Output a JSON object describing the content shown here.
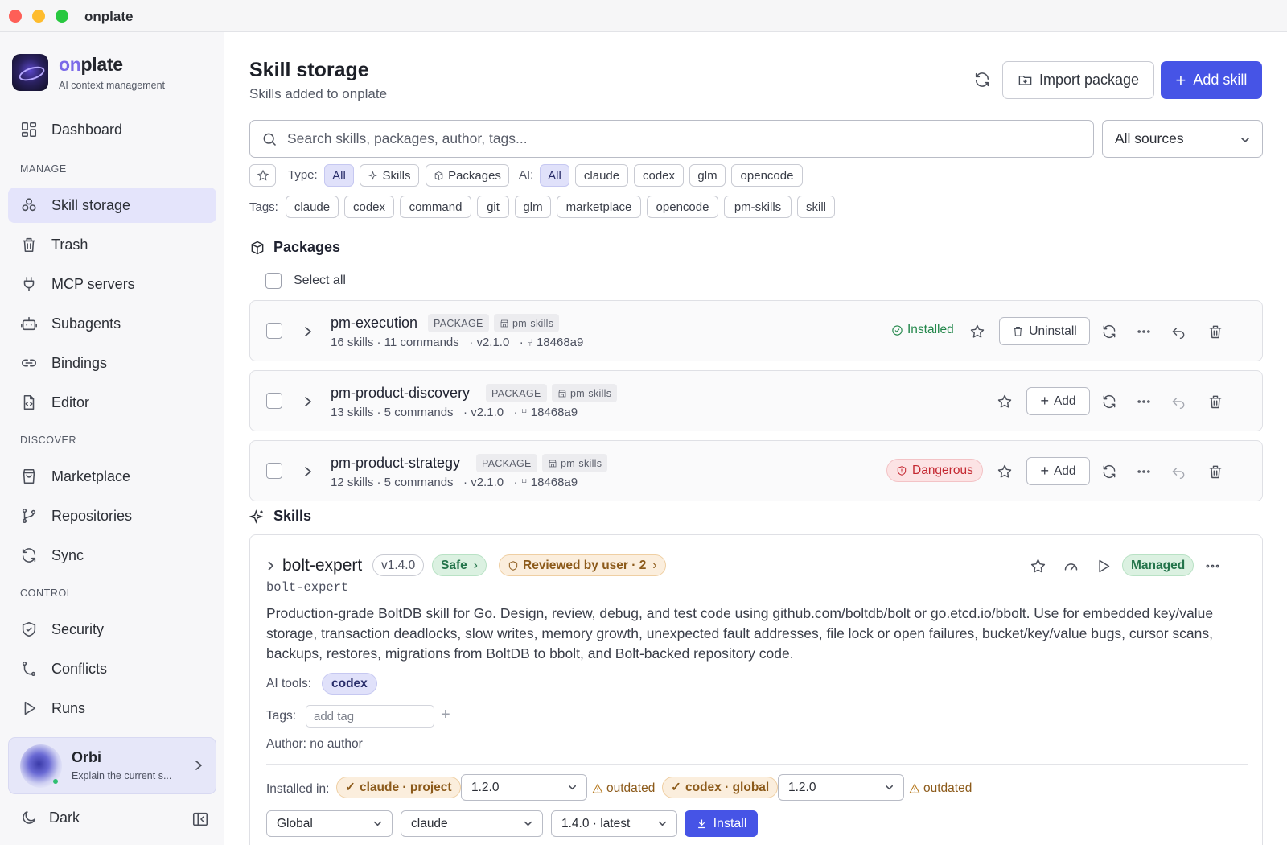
{
  "window": {
    "title": "onplate"
  },
  "brand": {
    "name_prefix": "on",
    "name_suffix": "plate",
    "subtitle": "AI context management"
  },
  "sidebar": {
    "dashboard": "Dashboard",
    "sections": {
      "manage": "MANAGE",
      "discover": "DISCOVER",
      "control": "CONTROL"
    },
    "manage_items": [
      "Skill storage",
      "Trash",
      "MCP servers",
      "Subagents",
      "Bindings",
      "Editor"
    ],
    "discover_items": [
      "Marketplace",
      "Repositories",
      "Sync"
    ],
    "control_items": [
      "Security",
      "Conflicts",
      "Runs"
    ],
    "active_item": "Skill storage",
    "assistant": {
      "name": "Orbi",
      "subtitle": "Explain the current s..."
    },
    "theme_label": "Dark"
  },
  "header": {
    "title": "Skill storage",
    "subtitle": "Skills added to onplate",
    "import_label": "Import package",
    "add_label": "Add skill"
  },
  "search": {
    "placeholder": "Search skills, packages, author, tags...",
    "sources_value": "All sources"
  },
  "filters": {
    "type_label": "Type:",
    "type_options": [
      "All",
      "Skills",
      "Packages"
    ],
    "type_selected": "All",
    "ai_label": "AI:",
    "ai_options": [
      "All",
      "claude",
      "codex",
      "glm",
      "opencode"
    ],
    "ai_selected": "All",
    "tags_label": "Tags:",
    "tags": [
      "claude",
      "codex",
      "command",
      "git",
      "glm",
      "marketplace",
      "opencode",
      "pm-skills",
      "skill"
    ]
  },
  "packages": {
    "heading": "Packages",
    "select_all": "Select all",
    "items": [
      {
        "name": "pm-execution",
        "kind": "PACKAGE",
        "source": "pm-skills",
        "meta": "16 skills · 11 commands   · v2.1.0   ·",
        "commit": "18468a9",
        "status": "Installed",
        "action": "Uninstall"
      },
      {
        "name": "pm-product-discovery",
        "kind": "PACKAGE",
        "source": "pm-skills",
        "meta": "13 skills · 5 commands   · v2.1.0   ·",
        "commit": "18468a9",
        "status": "",
        "action": "Add"
      },
      {
        "name": "pm-product-strategy",
        "kind": "PACKAGE",
        "source": "pm-skills",
        "meta": "12 skills · 5 commands   · v2.1.0   ·",
        "commit": "18468a9",
        "status": "Dangerous",
        "action": "Add"
      }
    ]
  },
  "skills": {
    "heading": "Skills",
    "card": {
      "name": "bolt-expert",
      "version": "v1.4.0",
      "safety": "Safe",
      "review": "Reviewed by user · 2",
      "managed": "Managed",
      "slug": "bolt-expert",
      "description": "Production-grade BoltDB skill for Go. Design, review, debug, and test code using github.com/boltdb/bolt or go.etcd.io/bbolt. Use for embedded key/value storage, transaction deadlocks, slow writes, memory growth, unexpected fault addresses, file lock or open failures, bucket/key/value bugs, cursor scans, backups, restores, migrations from BoltDB to bbolt, and Bolt-backed repository code.",
      "ai_tools_label": "AI tools:",
      "ai_tools": [
        "codex"
      ],
      "tags_label": "Tags:",
      "tag_placeholder": "add tag",
      "author": "Author: no author",
      "installed_label": "Installed in:",
      "installs": [
        {
          "target": "claude · project",
          "version": "1.2.0",
          "state": "outdated"
        },
        {
          "target": "codex · global",
          "version": "1.2.0",
          "state": "outdated"
        }
      ],
      "install_scope": "Global",
      "install_tool": "claude",
      "install_version": "1.4.0 · latest",
      "install_label": "Install"
    }
  }
}
